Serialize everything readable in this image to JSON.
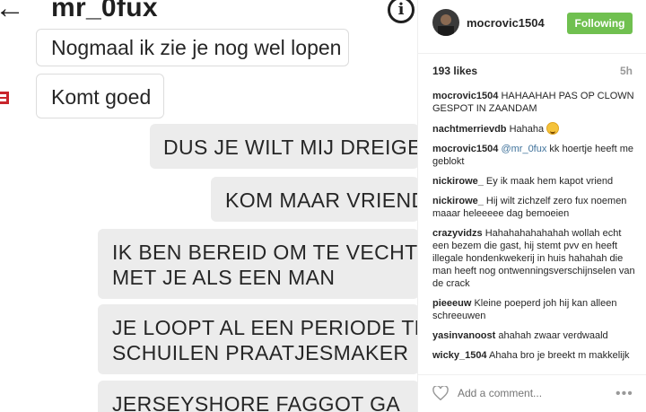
{
  "chat": {
    "title": "mr_0fux",
    "back_icon": "arrow-left-icon",
    "info_icon": "info-icon",
    "messages": [
      {
        "direction": "in",
        "text": "Nogmaal ik zie je nog wel lopen"
      },
      {
        "direction": "in",
        "text": "Komt goed"
      },
      {
        "direction": "out",
        "text": "DUS JE WILT MIJ DREIGEN"
      },
      {
        "direction": "out",
        "text": "KOM MAAR VRIEND"
      },
      {
        "direction": "out",
        "lines": [
          "IK BEN BEREID OM TE VECHTEN",
          "MET JE ALS EEN MAN"
        ]
      },
      {
        "direction": "out",
        "lines": [
          "JE LOOPT AL EEN PERIODE TE",
          "SCHUILEN PRAATJESMAKER"
        ]
      },
      {
        "direction": "out",
        "text": "JERSEYSHORE FAGGOT GA"
      }
    ]
  },
  "post": {
    "username": "mocrovic1504",
    "follow_label": "Following",
    "likes": "193 likes",
    "age": "5h",
    "comments": [
      {
        "user": "mocrovic1504",
        "text": "HAHAAHAH PAS OP CLOWN GESPOT IN ZAANDAM"
      },
      {
        "user": "nachtmerrievdb",
        "text": "Hahaha",
        "emoji": "laughing-emoji"
      },
      {
        "user": "mocrovic1504",
        "mention": "@mr_0fux",
        "text": "kk hoertje heeft me geblokt"
      },
      {
        "user": "nickirowe_",
        "text": "Ey ik maak hem kapot vriend"
      },
      {
        "user": "nickirowe_",
        "text": "Hij wilt zichzelf zero fux noemen maaar heleeeee dag bemoeien"
      },
      {
        "user": "crazyvidzs",
        "text": "Hahahahahahahah wollah echt een bezem die gast, hij stemt pvv en heeft illegale hondenkwekerij in huis hahahah die man heeft nog ontwenningsverschijnselen van de crack"
      },
      {
        "user": "pieeeuw",
        "text": "Kleine poeperd joh hij kan alleen schreeuwen"
      },
      {
        "user": "yasinvanoost",
        "text": "ahahah zwaar verdwaald"
      },
      {
        "user": "wicky_1504",
        "text": "Ahaha bro je breekt m makkelijk"
      }
    ],
    "add_comment_placeholder": "Add a comment...",
    "more_label": "•••",
    "colors": {
      "follow": "#70c050",
      "mention": "#3f729b",
      "muted": "#999999"
    }
  }
}
